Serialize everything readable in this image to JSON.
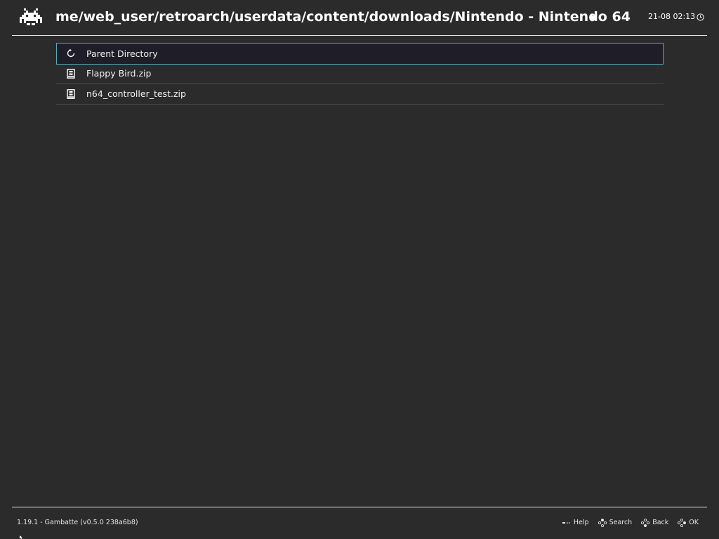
{
  "header": {
    "title": "me/web_user/retroarch/userdata/content/downloads/Nintendo - Nintendo 64",
    "clock": "21-08 02:13",
    "logo_icon": "retroarch-invader-icon",
    "clock_icon": "clock-icon"
  },
  "list": {
    "selected_index": 0,
    "items": [
      {
        "label": "Parent Directory",
        "icon": "refresh-icon"
      },
      {
        "label": "Flappy Bird.zip",
        "icon": "file-icon"
      },
      {
        "label": "n64_controller_test.zip",
        "icon": "file-icon"
      }
    ]
  },
  "footer": {
    "version": "1.19.1 - Gambatte (v0.5.0 238a6b8)",
    "actions": {
      "help": "Help",
      "search": "Search",
      "back": "Back",
      "ok": "OK"
    }
  },
  "colors": {
    "background": "#2b2b2b",
    "selection_border": "#5aa8b8",
    "selection_fill": "#1f1d27",
    "divider": "#4a4a4a",
    "text": "#ffffff"
  }
}
